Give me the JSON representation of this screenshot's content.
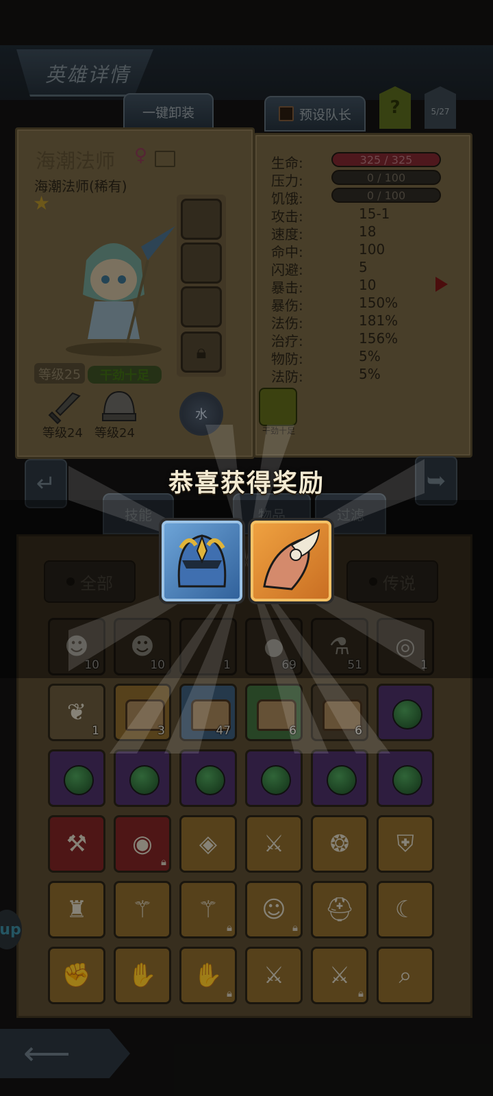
{
  "header": {
    "title": "英雄详情",
    "unequip_all": "一键卸装",
    "preset_leader": "预设队长",
    "help": "?",
    "page_count": "5/27"
  },
  "hero": {
    "name": "海潮法师",
    "gender_symbol": "♀",
    "class": "海潮法师(稀有)",
    "level": "等级25",
    "mood": "干劲十足",
    "weapon_level": "等级24",
    "armor_level": "等级24",
    "element": "水",
    "trait_label": "干劲十足"
  },
  "stats": {
    "hp_label": "生命:",
    "hp_value": "325 / 325",
    "stress_label": "压力:",
    "stress_value": "0 / 100",
    "hunger_label": "饥饿:",
    "hunger_value": "0 / 100",
    "rows": [
      {
        "label": "攻击:",
        "value": "15-1"
      },
      {
        "label": "速度:",
        "value": "18"
      },
      {
        "label": "命中:",
        "value": "100"
      },
      {
        "label": "闪避:",
        "value": "5"
      },
      {
        "label": "暴击:",
        "value": "10"
      },
      {
        "label": "暴伤:",
        "value": "150%"
      },
      {
        "label": "法伤:",
        "value": "181%"
      },
      {
        "label": "治疗:",
        "value": "156%"
      },
      {
        "label": "物防:",
        "value": "5%"
      },
      {
        "label": "法防:",
        "value": "5%"
      }
    ]
  },
  "tabs": {
    "skills": "技能",
    "items": "物品",
    "filter": "过滤"
  },
  "filters": {
    "all": "全部",
    "legend": "传说"
  },
  "reward": {
    "title": "恭喜获得奖励",
    "item1": "helmet-icon",
    "item2": "shoulder-guard-icon"
  },
  "inventory": {
    "row1": [
      "10",
      "10",
      "1",
      "69",
      "51",
      "1"
    ],
    "row2": [
      "1",
      "3",
      "47",
      "6",
      "6",
      ""
    ]
  },
  "side_bubble": "up",
  "colors": {
    "hp_bar": "#7e2730",
    "panel": "#756443",
    "reward_blue": "#3c6fa8",
    "reward_gold": "#e08b32"
  }
}
